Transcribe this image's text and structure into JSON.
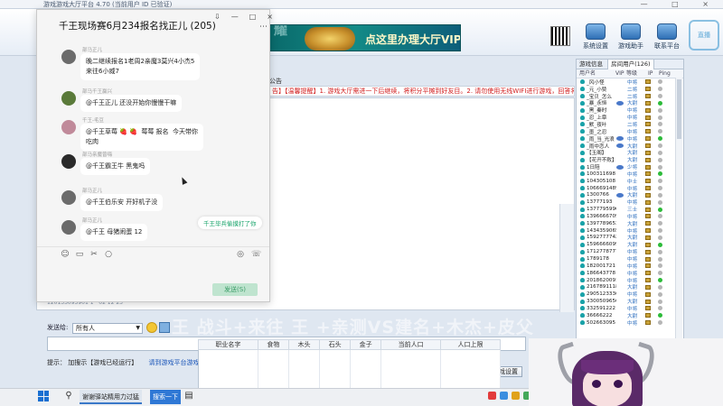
{
  "app": {
    "title": "游戏游戏大厅平台 4.70 (当前用户 ID 已验证)",
    "window_controls": "— □ ×",
    "vip_banner": {
      "bg_text": "耀",
      "text": "点这里办理大厅VIP"
    },
    "header_buttons": [
      {
        "label": "系统设置",
        "icon": "settings-icon"
      },
      {
        "label": "游戏助手",
        "icon": "helper-icon"
      },
      {
        "label": "联系平台",
        "icon": "contact-icon"
      }
    ],
    "watermark": "直播"
  },
  "announcement": {
    "label": "公告",
    "text": "告】【温馨提醒】1. 游戏大厅需进一下后继续，将积分平摊到好友目。2. 请勿使用无线WIFI进行游戏，回答将不被处，容易解"
  },
  "chat_area": {
    "timestamp": "120133093901 1 · 02 12 23"
  },
  "send_bar": {
    "send_to_label": "发送给:",
    "send_to_value": "所有人",
    "tip_label": "提示：",
    "tip_text": "加搜示【游戏已经运行】",
    "tip_link": "请到游戏平台游戏大厅中",
    "settings_button": "游戏设置"
  },
  "overlay_text": "王 战斗+来往  王 +亲测VS建名+木杰+皮父",
  "resource_table": {
    "headers": [
      "职业名字",
      "食物",
      "木头",
      "石头",
      "金子",
      "当前人口",
      "人口上限"
    ]
  },
  "user_panel": {
    "tabs": [
      "游戏信息",
      "房间用户(126)"
    ],
    "columns": [
      "用户名",
      "VIP",
      "等级",
      "IP",
      "Ping"
    ],
    "users": [
      {
        "name": "_风小怪",
        "vip": false,
        "level": "中将"
      },
      {
        "name": "_元_小赞",
        "vip": false,
        "level": "二将"
      },
      {
        "name": "_宝贝_怎么",
        "vip": false,
        "level": "二将"
      },
      {
        "name": "_暴_永恒",
        "vip": true,
        "level": "大尉"
      },
      {
        "name": "_黑_秦时",
        "vip": false,
        "level": "中将"
      },
      {
        "name": "_忍_上章",
        "vip": false,
        "level": "中将"
      },
      {
        "name": "_默_夜叶",
        "vip": false,
        "level": "二将"
      },
      {
        "name": "_墨_之忍",
        "vip": false,
        "level": "中将"
      },
      {
        "name": "_雨_当_光浪",
        "vip": true,
        "level": "中将"
      },
      {
        "name": "_雨中恋人",
        "vip": true,
        "level": "大尉"
      },
      {
        "name": "【玉阁】",
        "vip": false,
        "level": "大尉"
      },
      {
        "name": "【花开不败】",
        "vip": false,
        "level": "大尉"
      },
      {
        "name": "1日陪",
        "vip": true,
        "level": "少将"
      },
      {
        "name": "100311698",
        "vip": false,
        "level": "中将"
      },
      {
        "name": "104305108",
        "vip": false,
        "level": "中士"
      },
      {
        "name": "1066691489",
        "vip": false,
        "level": "中将"
      },
      {
        "name": "1300766",
        "vip": true,
        "level": "大尉"
      },
      {
        "name": "13777193",
        "vip": false,
        "level": "中将"
      },
      {
        "name": "13777959961",
        "vip": false,
        "level": "三士"
      },
      {
        "name": "13966667099",
        "vip": false,
        "level": "中将"
      },
      {
        "name": "13977896539",
        "vip": false,
        "level": "大尉"
      },
      {
        "name": "1434359065",
        "vip": false,
        "level": "中将"
      },
      {
        "name": "15927777421",
        "vip": false,
        "level": "大尉"
      },
      {
        "name": "15966660997",
        "vip": false,
        "level": "大尉"
      },
      {
        "name": "1712778777",
        "vip": false,
        "level": "中将"
      },
      {
        "name": "1789178",
        "vip": false,
        "level": "中将"
      },
      {
        "name": "182001721",
        "vip": false,
        "level": "中将"
      },
      {
        "name": "186643778",
        "vip": false,
        "level": "中将"
      },
      {
        "name": "2018620091",
        "vip": false,
        "level": "中将"
      },
      {
        "name": "2167891118",
        "vip": false,
        "level": "大尉"
      },
      {
        "name": "2905123336",
        "vip": false,
        "level": "中将"
      },
      {
        "name": "3300509656",
        "vip": false,
        "level": "大尉"
      },
      {
        "name": "332591222",
        "vip": false,
        "level": "中将"
      },
      {
        "name": "36666222",
        "vip": false,
        "level": "大尉"
      },
      {
        "name": "502663095",
        "vip": false,
        "level": "中将"
      }
    ]
  },
  "chat_window": {
    "title": "千王现场赛6月234报名找正儿 (205)",
    "controls": [
      "⇩",
      "—",
      "□",
      "×"
    ],
    "more": "⋯",
    "messages": [
      {
        "sender": "部马正儿",
        "text": "晚二继续报名1老周2亲魔3莫兴4小杰5\n来往6小威7",
        "avatar_color": "#6b6b6b"
      },
      {
        "sender": "部马千王赢兴",
        "text": "@千王正儿 还没开始你慢慢干嘛",
        "avatar_color": "#5a7a3a"
      },
      {
        "sender": "千王-毛豆",
        "text": "@千王草莓 🍓 🍓  莓莓 报名  今天带你\n吃肉",
        "avatar_color": "#c08a9a"
      },
      {
        "sender": "部马亲魔曾嗨",
        "text": "@千王霸王牛 黑鬼吗",
        "avatar_color": "#2a2a2a"
      },
      {
        "sender": "部马正儿",
        "text": "@千王伯乐安 开好机子没",
        "avatar_color": "#6b6b6b"
      },
      {
        "sender": "部马正儿",
        "text": "@千王 母猪闹蛋 12",
        "avatar_color": "#6b6b6b"
      }
    ],
    "quick_reply": "千王毕兵偷摸打了你",
    "tool_icons": [
      "☺",
      "▭",
      "✂",
      "○",
      "◎",
      "☏"
    ],
    "send_button": "发送(S)"
  },
  "taskbar": {
    "apps": [
      {
        "label": "谢谢驿站精用力过猛",
        "active": false
      },
      {
        "label": "搜索一下",
        "active": true
      }
    ]
  }
}
